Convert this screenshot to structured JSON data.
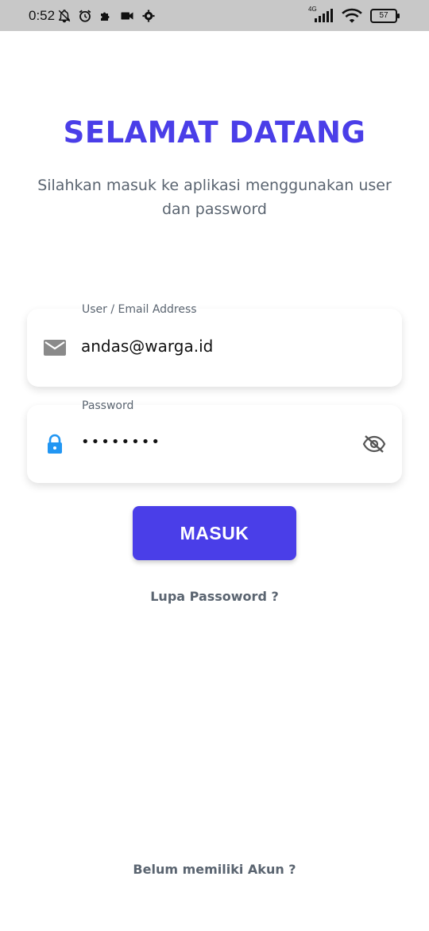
{
  "status_bar": {
    "time": "0:52",
    "left_icons": [
      "notifications-off-icon",
      "alarm-icon",
      "puzzle-icon",
      "video-camera-icon",
      "settings-icon"
    ],
    "network": "4G",
    "battery": "57"
  },
  "login": {
    "title": "SELAMAT DATANG",
    "subtitle": "Silahkan masuk ke aplikasi menggunakan user dan password",
    "email": {
      "label": "User / Email Address",
      "value": "andas@warga.id",
      "icon": "mail-icon"
    },
    "password": {
      "label": "Password",
      "value": "••••••••",
      "icon": "lock-icon",
      "toggle_icon": "eye-off-icon"
    },
    "submit_label": "MASUK",
    "forgot_label": "Lupa Passoword ?",
    "register_label": "Belum memiliki Akun ?"
  },
  "colors": {
    "accent": "#4a3ee8",
    "muted_text": "#5a6470",
    "lock_icon": "#2196f3",
    "mail_icon": "#8a8a8a"
  }
}
